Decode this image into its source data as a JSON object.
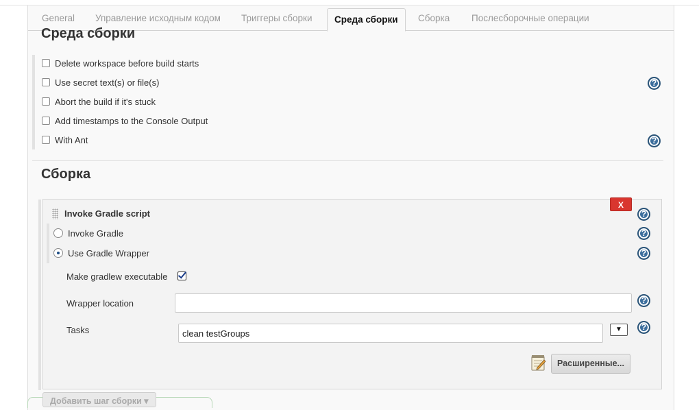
{
  "tabs": [
    {
      "label": "General"
    },
    {
      "label": "Управление исходным кодом"
    },
    {
      "label": "Триггеры сборки"
    },
    {
      "label": "Среда сборки"
    },
    {
      "label": "Сборка"
    },
    {
      "label": "Послесборочные операции"
    }
  ],
  "build_env": {
    "title": "Среда сборки",
    "options": [
      {
        "label": "Delete workspace before build starts",
        "checked": false
      },
      {
        "label": "Use secret text(s) or file(s)",
        "checked": false
      },
      {
        "label": "Abort the build if it's stuck",
        "checked": false
      },
      {
        "label": "Add timestamps to the Console Output",
        "checked": false
      },
      {
        "label": "With Ant",
        "checked": false
      }
    ]
  },
  "build": {
    "title": "Сборка",
    "step": {
      "title": "Invoke Gradle script",
      "delete_label": "X",
      "radio_invoke_gradle": "Invoke Gradle",
      "radio_use_wrapper": "Use Gradle Wrapper",
      "selected": "Use Gradle Wrapper",
      "make_executable_label": "Make gradlew executable",
      "make_executable_checked": true,
      "wrapper_location_label": "Wrapper location",
      "wrapper_location_value": "",
      "tasks_label": "Tasks",
      "tasks_value": "clean testGroups",
      "advanced_label": "Расширенные..."
    },
    "add_step_label": "Добавить шаг сборки"
  },
  "help_icon_glyph": "?",
  "colors": {
    "accent": "#3c6e9d",
    "danger": "#d9362f"
  }
}
